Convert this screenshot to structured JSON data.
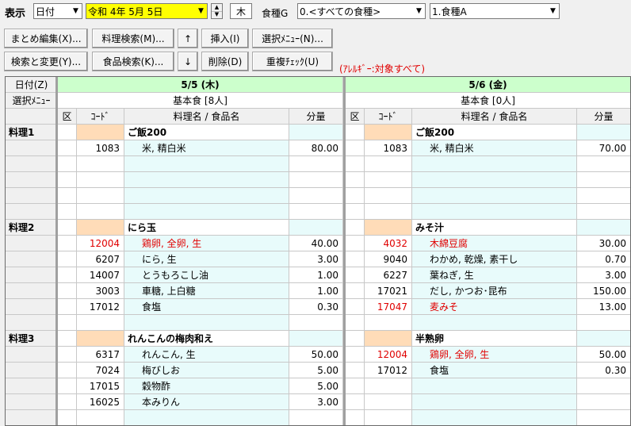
{
  "top": {
    "display_label": "表示",
    "display_mode": "日付",
    "date_value": "令和 4年 5月 5日",
    "weekday": "木",
    "food_group_label": "食種G",
    "food_group_value": "0.<すべての食種>",
    "food_type_value": "1.食種A"
  },
  "toolbar": {
    "matome": "まとめ編集(X)...",
    "ryouri_search": "料理検索(M)...",
    "up": "↑",
    "insert": "挿入(I)",
    "select_menu": "選択ﾒﾆｭｰ(N)...",
    "search_replace": "検索と変更(Y)...",
    "food_search": "食品検索(K)...",
    "down": "↓",
    "delete": "削除(D)",
    "dup_check": "重複ﾁｪｯｸ(U)",
    "allergy_note": "(ｱﾚﾙｷﾞｰ:対象すべて)"
  },
  "grid": {
    "date_header": "日付(Z)",
    "select_menu_header": "選択ﾒﾆｭｰ",
    "col_kubun": "区",
    "col_code": "ｺｰﾄﾞ",
    "col_name": "料理名 / 食品名",
    "col_amount": "分量",
    "days": [
      {
        "date": "5/5 (木)",
        "menu": "基本食 [8人]",
        "dishes": [
          {
            "label": "料理1",
            "name": "ご飯200",
            "rows": [
              {
                "code": "1083",
                "food": "米, 精白米",
                "amount": "80.00",
                "allergen": false
              }
            ]
          },
          {
            "label": "料理2",
            "name": "にら玉",
            "rows": [
              {
                "code": "12004",
                "food": "鶏卵, 全卵, 生",
                "amount": "40.00",
                "allergen": true
              },
              {
                "code": "6207",
                "food": "にら, 生",
                "amount": "3.00",
                "allergen": false
              },
              {
                "code": "14007",
                "food": "とうもろこし油",
                "amount": "1.00",
                "allergen": false
              },
              {
                "code": "3003",
                "food": "車糖, 上白糖",
                "amount": "1.00",
                "allergen": false
              },
              {
                "code": "17012",
                "food": "食塩",
                "amount": "0.30",
                "allergen": false
              }
            ]
          },
          {
            "label": "料理3",
            "name": "れんこんの梅肉和え",
            "rows": [
              {
                "code": "6317",
                "food": "れんこん, 生",
                "amount": "50.00",
                "allergen": false
              },
              {
                "code": "7024",
                "food": "梅びしお",
                "amount": "5.00",
                "allergen": false
              },
              {
                "code": "17015",
                "food": "穀物酢",
                "amount": "5.00",
                "allergen": false
              },
              {
                "code": "16025",
                "food": "本みりん",
                "amount": "3.00",
                "allergen": false
              }
            ]
          }
        ]
      },
      {
        "date": "5/6 (金)",
        "menu": "基本食 [0人]",
        "dishes": [
          {
            "label": "",
            "name": "ご飯200",
            "rows": [
              {
                "code": "1083",
                "food": "米, 精白米",
                "amount": "70.00",
                "allergen": false
              }
            ]
          },
          {
            "label": "",
            "name": "みそ汁",
            "rows": [
              {
                "code": "4032",
                "food": "木綿豆腐",
                "amount": "30.00",
                "allergen": true
              },
              {
                "code": "9040",
                "food": "わかめ, 乾燥, 素干し",
                "amount": "0.70",
                "allergen": false
              },
              {
                "code": "6227",
                "food": "葉ねぎ, 生",
                "amount": "3.00",
                "allergen": false
              },
              {
                "code": "17021",
                "food": "だし, かつお･昆布",
                "amount": "150.00",
                "allergen": false
              },
              {
                "code": "17047",
                "food": "麦みそ",
                "amount": "13.00",
                "allergen": true
              }
            ]
          },
          {
            "label": "",
            "name": "半熟卵",
            "rows": [
              {
                "code": "12004",
                "food": "鶏卵, 全卵, 生",
                "amount": "50.00",
                "allergen": true
              },
              {
                "code": "17012",
                "food": "食塩",
                "amount": "0.30",
                "allergen": false
              }
            ]
          }
        ]
      }
    ]
  }
}
